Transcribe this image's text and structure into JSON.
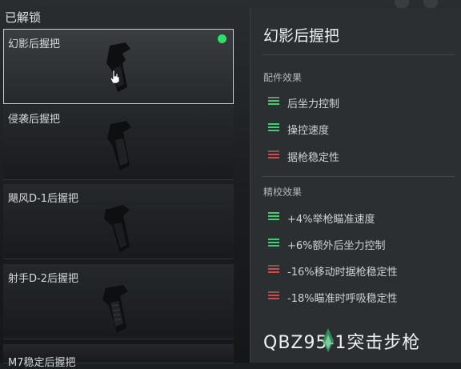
{
  "unlocked_section": {
    "title": "已解锁"
  },
  "attachments": [
    {
      "name": "幻影后握把",
      "selected": true,
      "equipped": true
    },
    {
      "name": "侵袭后握把",
      "selected": false,
      "equipped": false
    },
    {
      "name": "飓风D-1后握把",
      "selected": false,
      "equipped": false
    },
    {
      "name": "射手D-2后握把",
      "selected": false,
      "equipped": false
    },
    {
      "name": "M7稳定后握把",
      "selected": false,
      "equipped": false
    }
  ],
  "detail": {
    "title": "幻影后握把",
    "effects_heading": "配件效果",
    "effects": [
      {
        "label": "后坐力控制",
        "tone": "positive"
      },
      {
        "label": "操控速度",
        "tone": "positive_strong"
      },
      {
        "label": "据枪稳定性",
        "tone": "negative"
      }
    ],
    "tuning_heading": "精校效果",
    "tuning": [
      {
        "label": "+4%举枪瞄准速度",
        "tone": "positive"
      },
      {
        "label": "+6%额外后坐力控制",
        "tone": "positive"
      },
      {
        "label": "-16%移动时据枪稳定性",
        "tone": "negative"
      },
      {
        "label": "-18%瞄准时呼吸稳定性",
        "tone": "negative"
      }
    ],
    "weapon_name": "QBZ95-1突击步枪"
  },
  "colors": {
    "positive": "#3fcf73",
    "negative": "#d64848",
    "equipped_dot": "#2ee06a",
    "selected_border": "#c9cbcd"
  },
  "icons": {
    "grip": "rear-grip-icon",
    "cursor": "hand-cursor-icon",
    "equipped": "equipped-dot-icon",
    "positive": "green-bars-icon",
    "negative": "red-bars-icon"
  }
}
